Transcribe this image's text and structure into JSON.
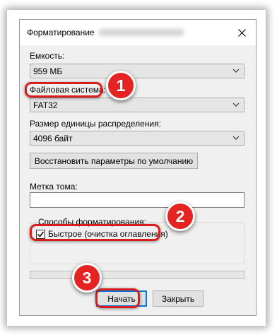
{
  "dialog": {
    "title": "Форматирование",
    "close_icon": "close-icon"
  },
  "capacity": {
    "label": "Емкость:",
    "value": "959 МБ"
  },
  "filesystem": {
    "label": "Файловая система:",
    "value": "FAT32"
  },
  "cluster": {
    "label": "Размер единицы распределения:",
    "value": "4096 байт"
  },
  "restore_defaults_label": "Восстановить параметры по умолчанию",
  "volume": {
    "label": "Метка тома:",
    "value": ""
  },
  "format_options": {
    "label": "Способы форматирования:",
    "quick_label": "Быстрое (очистка оглавления)",
    "quick_checked": true
  },
  "progress": {
    "fraction": 0
  },
  "buttons": {
    "start": "Начать",
    "close": "Закрыть"
  },
  "annotations": {
    "step1": "1",
    "step2": "2",
    "step3": "3"
  },
  "colors": {
    "highlight": "#d91c1c",
    "badge": "#e52322",
    "focus": "#0078d7"
  }
}
